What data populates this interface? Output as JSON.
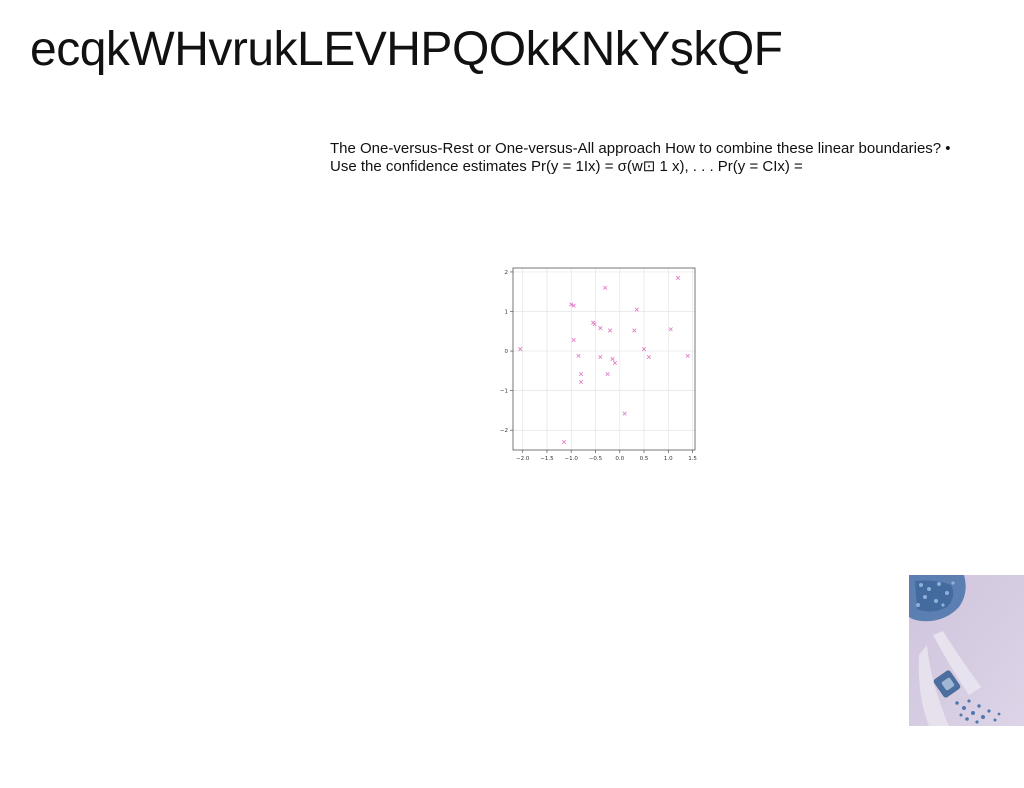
{
  "slide": {
    "title": "ecqkWHvrukLEVHPQOkKNkYskQF",
    "body_text": "The One-versus-Rest or One-versus-All approach How to combine these linear boundaries? • Use the confidence estimates Pr(y = 1Ix) = σ(w⊡ 1 x), . . . Pr(y = CIx) ="
  },
  "chart_data": {
    "type": "scatter",
    "title": "",
    "xlabel": "",
    "ylabel": "",
    "xlim": [
      -2.2,
      1.55
    ],
    "ylim": [
      -2.5,
      2.1
    ],
    "xticks": [
      "−2.0",
      "−1.5",
      "−1.0",
      "−0.5",
      "0.0",
      "0.5",
      "1.0",
      "1.5"
    ],
    "yticks": [
      "2",
      "1",
      "0",
      "−1",
      "−2"
    ],
    "grid": true,
    "marker": "x",
    "color": "#e377c2",
    "series": [
      {
        "points": [
          [
            -2.05,
            0.05
          ],
          [
            -1.0,
            1.18
          ],
          [
            -0.95,
            1.15
          ],
          [
            -0.3,
            1.6
          ],
          [
            1.2,
            1.85
          ],
          [
            0.35,
            1.05
          ],
          [
            -0.55,
            0.72
          ],
          [
            -0.52,
            0.68
          ],
          [
            -0.4,
            0.58
          ],
          [
            -0.2,
            0.52
          ],
          [
            0.3,
            0.52
          ],
          [
            1.05,
            0.55
          ],
          [
            -0.95,
            0.28
          ],
          [
            -0.85,
            -0.12
          ],
          [
            -0.4,
            -0.15
          ],
          [
            -0.15,
            -0.2
          ],
          [
            -0.1,
            -0.3
          ],
          [
            0.5,
            0.05
          ],
          [
            0.6,
            -0.15
          ],
          [
            1.4,
            -0.12
          ],
          [
            -0.8,
            -0.58
          ],
          [
            -0.8,
            -0.78
          ],
          [
            -0.25,
            -0.58
          ],
          [
            0.1,
            -1.58
          ],
          [
            -1.15,
            -2.3
          ]
        ]
      }
    ]
  },
  "decor": {
    "photo_icon": "blue-granules-photo"
  }
}
